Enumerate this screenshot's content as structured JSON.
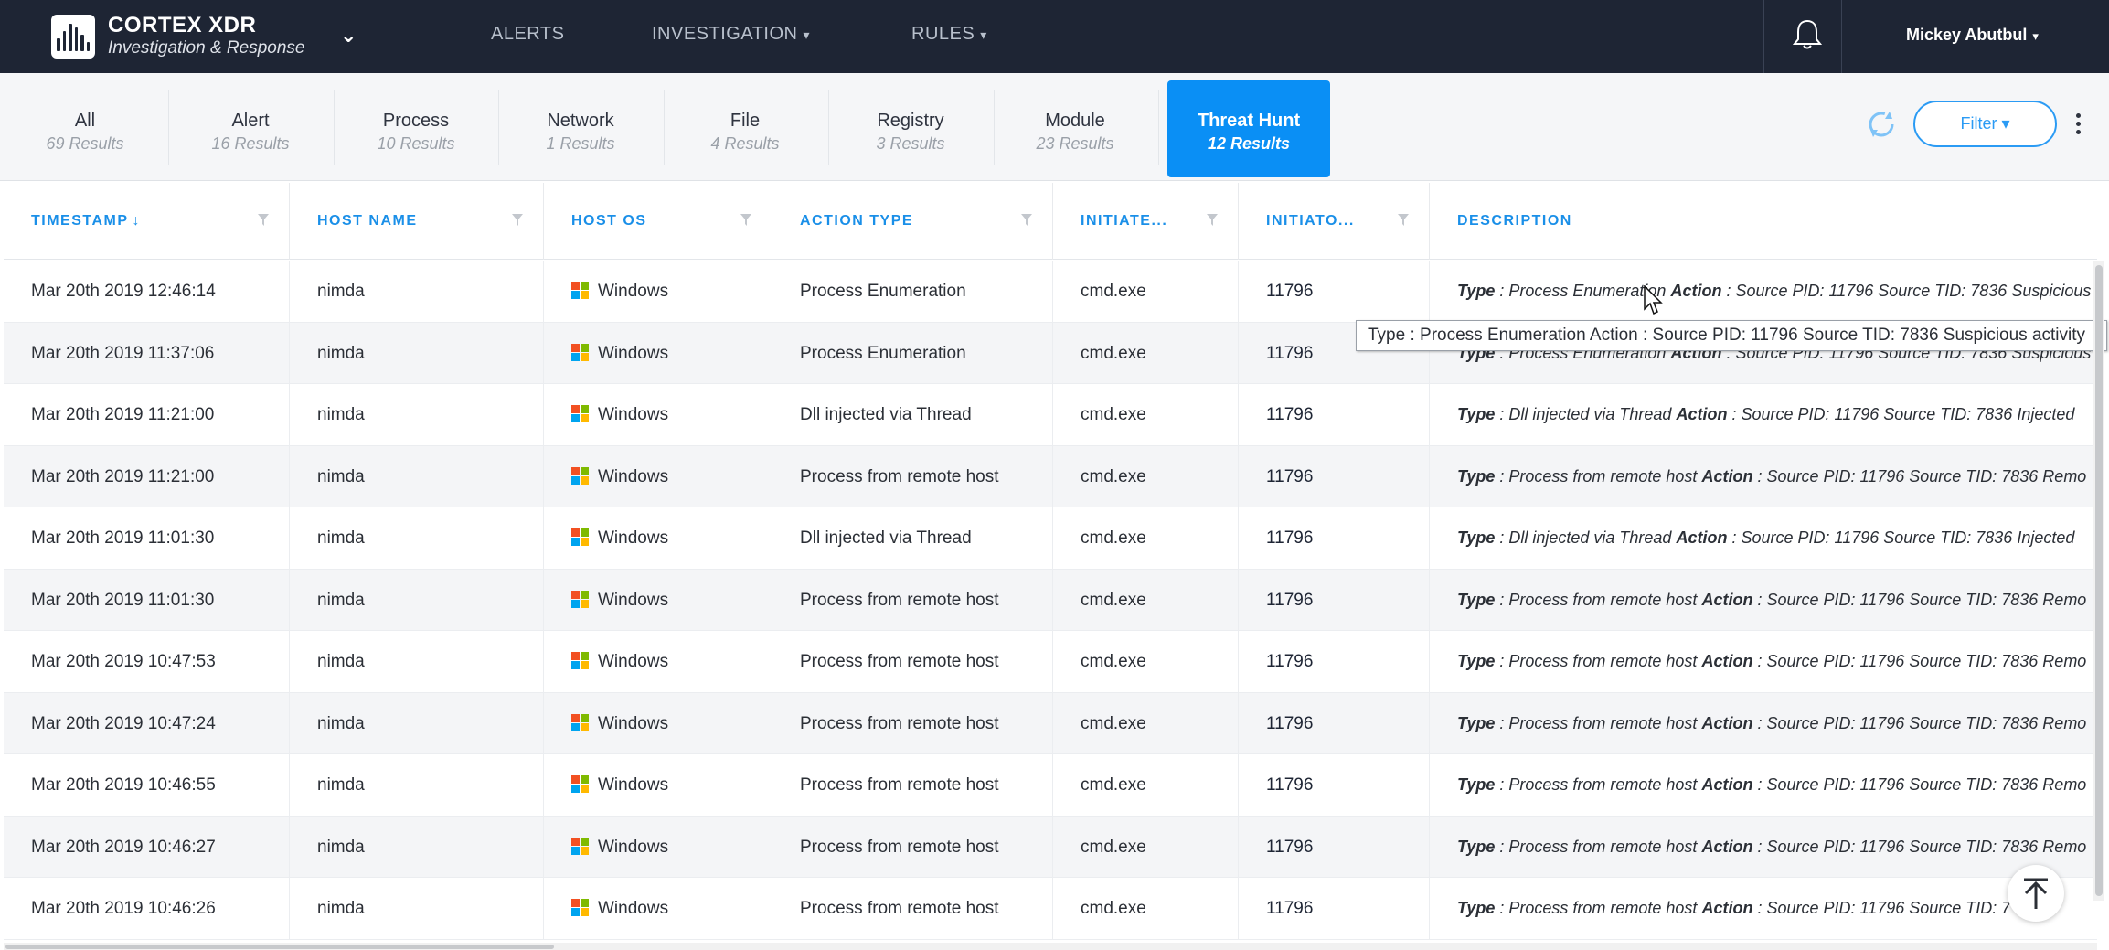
{
  "header": {
    "brand_title": "CORTEX XDR",
    "brand_subtitle": "Investigation & Response",
    "nav": {
      "alerts": "ALERTS",
      "investigation": "INVESTIGATION",
      "rules": "RULES"
    },
    "user_name": "Mickey Abutbul"
  },
  "tabs": [
    {
      "name": "All",
      "count": "69 Results"
    },
    {
      "name": "Alert",
      "count": "16 Results"
    },
    {
      "name": "Process",
      "count": "10 Results"
    },
    {
      "name": "Network",
      "count": "1 Results"
    },
    {
      "name": "File",
      "count": "4 Results"
    },
    {
      "name": "Registry",
      "count": "3 Results"
    },
    {
      "name": "Module",
      "count": "23 Results"
    },
    {
      "name": "Threat Hunt",
      "count": "12 Results"
    }
  ],
  "active_tab": "Threat Hunt",
  "toolbar": {
    "filter_label": "Filter ▾"
  },
  "columns": {
    "timestamp": "TIMESTAMP",
    "host_name": "HOST NAME",
    "host_os": "HOST OS",
    "action_type": "ACTION TYPE",
    "initiator": "INITIATE...",
    "initiator_pid": "INITIATO...",
    "description": "DESCRIPTION"
  },
  "rows": [
    {
      "ts": "Mar 20th 2019 12:46:14",
      "host": "nimda",
      "os": "Windows",
      "action": "Process Enumeration",
      "init": "cmd.exe",
      "pid": "11796",
      "d_type": "Process Enumeration",
      "d_rest": ": Source PID: 11796 Source TID: 7836 Suspicious"
    },
    {
      "ts": "Mar 20th 2019 11:37:06",
      "host": "nimda",
      "os": "Windows",
      "action": "Process Enumeration",
      "init": "cmd.exe",
      "pid": "11796",
      "d_type": "Process Enumeration",
      "d_rest": ": Source PID: 11796 Source TID: 7836 Suspicious"
    },
    {
      "ts": "Mar 20th 2019 11:21:00",
      "host": "nimda",
      "os": "Windows",
      "action": "Dll injected via Thread",
      "init": "cmd.exe",
      "pid": "11796",
      "d_type": "Dll injected via Thread",
      "d_rest": ": Source PID: 11796 Source TID: 7836 Injected"
    },
    {
      "ts": "Mar 20th 2019 11:21:00",
      "host": "nimda",
      "os": "Windows",
      "action": "Process from remote host",
      "init": "cmd.exe",
      "pid": "11796",
      "d_type": "Process from remote host",
      "d_rest": ": Source PID: 11796 Source TID: 7836 Remo"
    },
    {
      "ts": "Mar 20th 2019 11:01:30",
      "host": "nimda",
      "os": "Windows",
      "action": "Dll injected via Thread",
      "init": "cmd.exe",
      "pid": "11796",
      "d_type": "Dll injected via Thread",
      "d_rest": ": Source PID: 11796 Source TID: 7836 Injected"
    },
    {
      "ts": "Mar 20th 2019 11:01:30",
      "host": "nimda",
      "os": "Windows",
      "action": "Process from remote host",
      "init": "cmd.exe",
      "pid": "11796",
      "d_type": "Process from remote host",
      "d_rest": ": Source PID: 11796 Source TID: 7836 Remo"
    },
    {
      "ts": "Mar 20th 2019 10:47:53",
      "host": "nimda",
      "os": "Windows",
      "action": "Process from remote host",
      "init": "cmd.exe",
      "pid": "11796",
      "d_type": "Process from remote host",
      "d_rest": ": Source PID: 11796 Source TID: 7836 Remo"
    },
    {
      "ts": "Mar 20th 2019 10:47:24",
      "host": "nimda",
      "os": "Windows",
      "action": "Process from remote host",
      "init": "cmd.exe",
      "pid": "11796",
      "d_type": "Process from remote host",
      "d_rest": ": Source PID: 11796 Source TID: 7836 Remo"
    },
    {
      "ts": "Mar 20th 2019 10:46:55",
      "host": "nimda",
      "os": "Windows",
      "action": "Process from remote host",
      "init": "cmd.exe",
      "pid": "11796",
      "d_type": "Process from remote host",
      "d_rest": ": Source PID: 11796 Source TID: 7836 Remo"
    },
    {
      "ts": "Mar 20th 2019 10:46:27",
      "host": "nimda",
      "os": "Windows",
      "action": "Process from remote host",
      "init": "cmd.exe",
      "pid": "11796",
      "d_type": "Process from remote host",
      "d_rest": ": Source PID: 11796 Source TID: 7836 Remo"
    },
    {
      "ts": "Mar 20th 2019 10:46:26",
      "host": "nimda",
      "os": "Windows",
      "action": "Process from remote host",
      "init": "cmd.exe",
      "pid": "11796",
      "d_type": "Process from remote host",
      "d_rest": ": Source PID: 11796 Source TID: 7"
    }
  ],
  "desc_labels": {
    "type": "Type",
    "action": "Action"
  },
  "tooltip": "Type : Process Enumeration Action : Source PID: 11796 Source TID: 7836 Suspicious activity",
  "icons": {
    "logo": "cortex-logo-icon",
    "bell": "bell-icon",
    "refresh": "refresh-icon",
    "more": "kebab-icon",
    "column_filter": "filter-icon",
    "os": "windows-icon",
    "back_to_top": "arrow-up-icon"
  },
  "colors": {
    "nav_bg": "#1e2534",
    "accent": "#0a8ff5",
    "header_text": "#1a8fe8",
    "win_red": "#f25022",
    "win_green": "#7fba00",
    "win_blue": "#00a4ef",
    "win_yellow": "#ffb900"
  }
}
